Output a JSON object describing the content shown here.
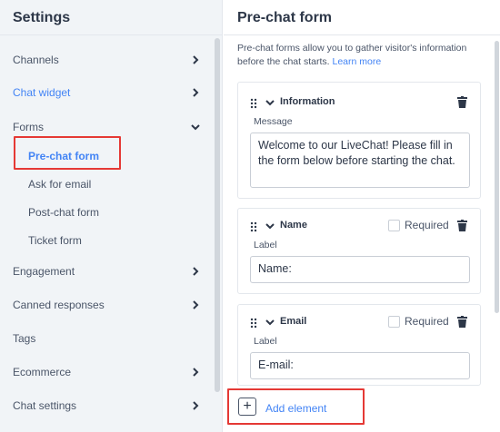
{
  "sidebar": {
    "title": "Settings",
    "items": [
      {
        "label": "Channels",
        "chevron": "right"
      },
      {
        "label": "Chat widget",
        "chevron": "right",
        "active": true
      },
      {
        "label": "Forms",
        "chevron": "down"
      },
      {
        "label": "Engagement",
        "chevron": "right"
      },
      {
        "label": "Canned responses",
        "chevron": "right"
      },
      {
        "label": "Tags",
        "chevron": null
      },
      {
        "label": "Ecommerce",
        "chevron": "right"
      },
      {
        "label": "Chat settings",
        "chevron": "right"
      }
    ],
    "forms_subitems": [
      {
        "label": "Pre-chat form",
        "selected": true
      },
      {
        "label": "Ask for email"
      },
      {
        "label": "Post-chat form"
      },
      {
        "label": "Ticket form"
      }
    ]
  },
  "main": {
    "title": "Pre-chat form",
    "description": "Pre-chat forms allow you to gather visitor's information before the chat starts.",
    "learn_more": "Learn more",
    "cards": [
      {
        "name": "Information",
        "field_label": "Message",
        "value": "Welcome to our LiveChat! Please fill in the form below before starting the chat."
      },
      {
        "name": "Name",
        "required_label": "Required",
        "field_label": "Label",
        "value": "Name:"
      },
      {
        "name": "Email",
        "required_label": "Required",
        "field_label": "Label",
        "value": "E-mail:"
      }
    ],
    "add_button": {
      "icon": "+",
      "label": "Add element"
    }
  },
  "colors": {
    "accent": "#4384f5",
    "highlight": "#e53935",
    "sidebar_bg": "#f1f4f7"
  }
}
